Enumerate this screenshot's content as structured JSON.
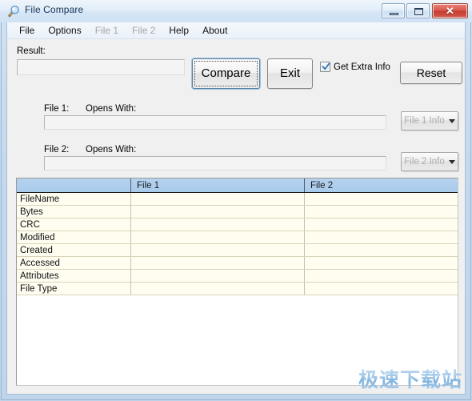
{
  "window": {
    "title": "File Compare",
    "icon": "magnifier-icon",
    "controls": {
      "minimize": "Minimize",
      "maximize": "Maximize",
      "close": "✕"
    }
  },
  "menubar": {
    "items": [
      {
        "label": "File",
        "disabled": false
      },
      {
        "label": "Options",
        "disabled": false
      },
      {
        "label": "File 1",
        "disabled": true
      },
      {
        "label": "File 2",
        "disabled": true
      },
      {
        "label": "Help",
        "disabled": false
      },
      {
        "label": "About",
        "disabled": false
      }
    ]
  },
  "form": {
    "result_label": "Result:",
    "result_value": "",
    "result_placeholder": "",
    "compare_button": "Compare",
    "exit_button": "Exit",
    "reset_button": "Reset",
    "extra_info_checkbox": {
      "label": "Get Extra Info",
      "checked": true
    },
    "file1": {
      "label": "File 1:",
      "opens_with_label": "Opens With:",
      "value": "",
      "info_button": "File 1 Info",
      "info_button_enabled": false
    },
    "file2": {
      "label": "File 2:",
      "opens_with_label": "Opens With:",
      "value": "",
      "info_button": "File 2 Info",
      "info_button_enabled": false
    }
  },
  "grid": {
    "headers": [
      "",
      "File 1",
      "File 2"
    ],
    "rows": [
      {
        "property": "FileName",
        "file1": "",
        "file2": ""
      },
      {
        "property": "Bytes",
        "file1": "",
        "file2": ""
      },
      {
        "property": "CRC",
        "file1": "",
        "file2": ""
      },
      {
        "property": "Modified",
        "file1": "",
        "file2": ""
      },
      {
        "property": "Created",
        "file1": "",
        "file2": ""
      },
      {
        "property": "Accessed",
        "file1": "",
        "file2": ""
      },
      {
        "property": "Attributes",
        "file1": "",
        "file2": ""
      },
      {
        "property": "File Type",
        "file1": "",
        "file2": ""
      }
    ]
  },
  "watermark": {
    "text": "极速下载站"
  },
  "colors": {
    "frame": "#c4d9ee",
    "client_bg": "#f0f0f0",
    "grid_header": "#a8cbec",
    "grid_cell": "#fffdf0",
    "close_button": "#c33d31",
    "watermark": "#9fc6e8"
  }
}
